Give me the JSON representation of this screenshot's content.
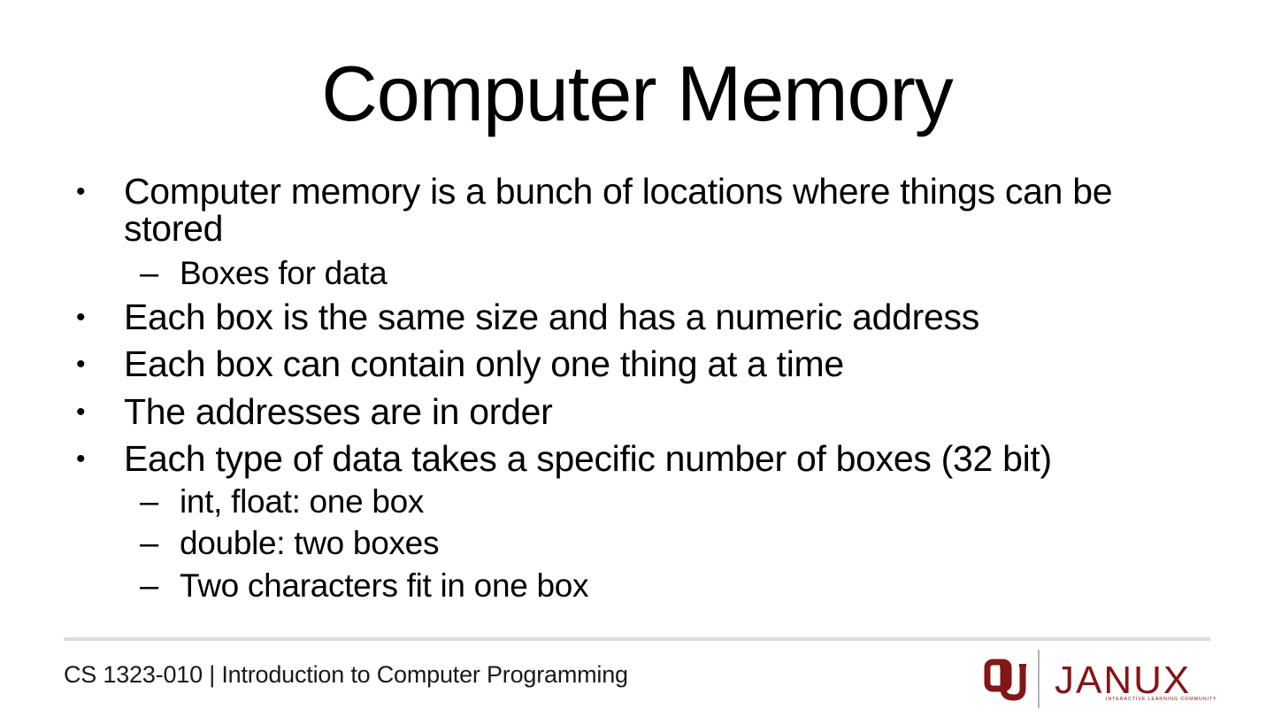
{
  "slide": {
    "title": "Computer Memory",
    "bullets": [
      {
        "level": 1,
        "marker": "•",
        "lines": [
          "Computer memory is a bunch of locations where things can be",
          "stored"
        ]
      },
      {
        "level": 2,
        "marker": "–",
        "lines": [
          "Boxes for data"
        ]
      },
      {
        "level": 1,
        "marker": "•",
        "lines": [
          "Each box is the same size and has a numeric address"
        ]
      },
      {
        "level": 1,
        "marker": "•",
        "lines": [
          "Each box can contain only one thing at a time"
        ]
      },
      {
        "level": 1,
        "marker": "•",
        "lines": [
          "The addresses are in order"
        ]
      },
      {
        "level": 1,
        "marker": "•",
        "lines": [
          "Each type of data takes a specific number of boxes (32 bit)"
        ]
      },
      {
        "level": 2,
        "marker": "–",
        "lines": [
          "int, float: one box"
        ]
      },
      {
        "level": 2,
        "marker": "–",
        "lines": [
          "double: two boxes"
        ]
      },
      {
        "level": 2,
        "marker": "–",
        "lines": [
          "Two characters fit in one box"
        ]
      }
    ]
  },
  "footer": {
    "course": "CS 1323-010 | Introduction to Computer Programming",
    "logo_wordmark": "JANUX",
    "logo_tagline": "INTERACTIVE LEARNING COMMUNITY",
    "logo_monogram": "OU",
    "brand_color": "#841617",
    "rule_color": "#dcdcdc"
  }
}
